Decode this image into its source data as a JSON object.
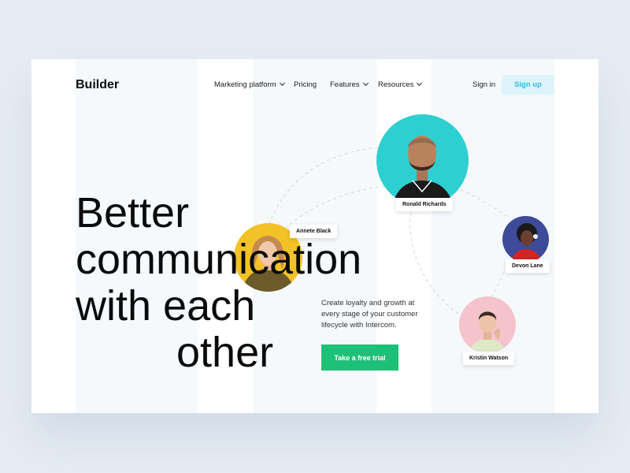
{
  "brand": {
    "logo_text": "Builder"
  },
  "nav": {
    "items": [
      {
        "label": "Marketing platform",
        "has_dropdown": true
      },
      {
        "label": "Pricing",
        "has_dropdown": false
      },
      {
        "label": "Features",
        "has_dropdown": true
      },
      {
        "label": "Resources",
        "has_dropdown": true
      }
    ],
    "sign_in": "Sign in",
    "sign_up": "Sign up"
  },
  "hero": {
    "headline_lines": [
      "Better",
      "communication",
      "with each",
      "other"
    ],
    "tagline": "Create loyalty and growth at every stage of your customer lifecycle with Intercom.",
    "cta_label": "Take a free trial"
  },
  "people": [
    {
      "name": "Ronald Richards",
      "bg_color": "#2ecfd1"
    },
    {
      "name": "Annete Black",
      "bg_color": "#f3c227"
    },
    {
      "name": "Devon Lane",
      "bg_color": "#3e4a9a"
    },
    {
      "name": "Kristin Watson",
      "bg_color": "#f4c3cb"
    }
  ],
  "colors": {
    "background": "#e6ecf3",
    "card": "#ffffff",
    "stripe": "#f5f9fb",
    "accent_blue": "#33b6e6",
    "signup_bg": "#def4fb",
    "cta_green": "#1ec077"
  }
}
